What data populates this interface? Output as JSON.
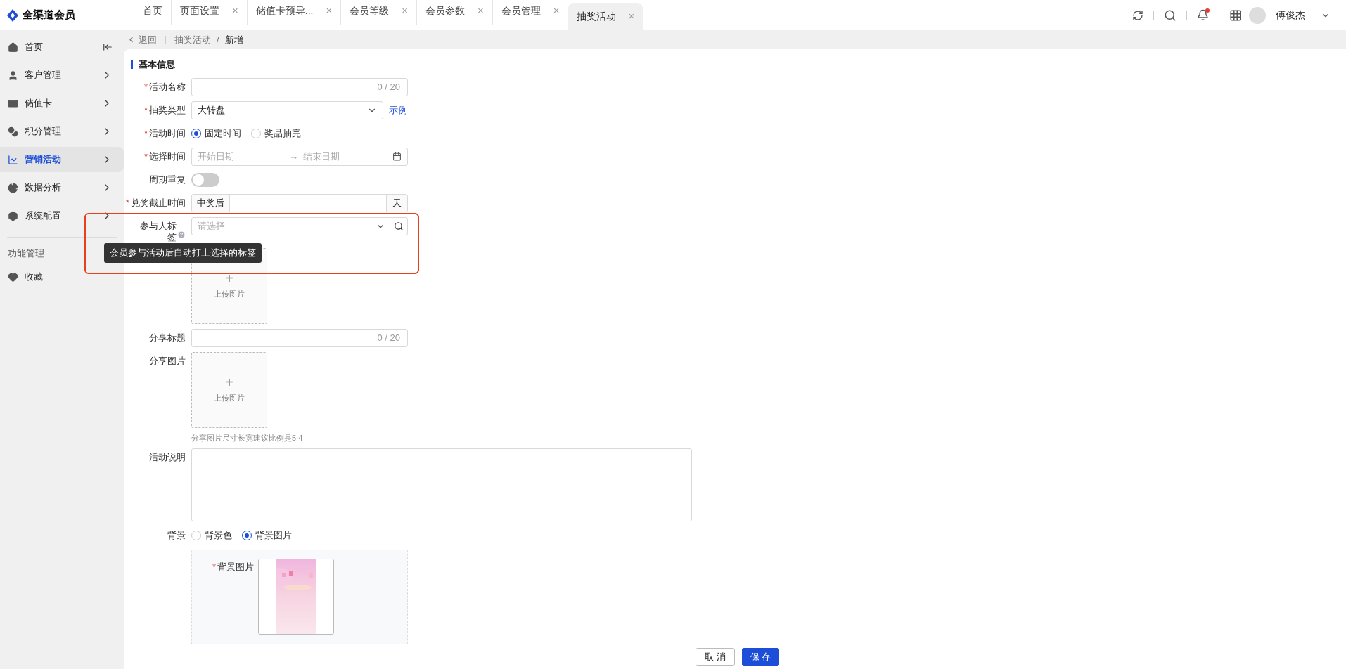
{
  "app": {
    "name": "全渠道会员"
  },
  "tabs": [
    {
      "label": "首页",
      "selected": false,
      "closable": false
    },
    {
      "label": "页面设置",
      "selected": false,
      "closable": true
    },
    {
      "label": "储值卡预导...",
      "selected": false,
      "closable": true
    },
    {
      "label": "会员等级",
      "selected": false,
      "closable": true
    },
    {
      "label": "会员参数",
      "selected": false,
      "closable": true
    },
    {
      "label": "会员管理",
      "selected": false,
      "closable": true
    },
    {
      "label": "抽奖活动",
      "selected": true,
      "closable": true
    }
  ],
  "close_glyph": "×",
  "user": {
    "name": "傅俊杰",
    "notification_dot": true
  },
  "sidebar": {
    "items": [
      {
        "label": "首页",
        "selected": false,
        "arrow": false
      },
      {
        "label": "客户管理",
        "selected": false,
        "arrow": true
      },
      {
        "label": "储值卡",
        "selected": false,
        "arrow": true
      },
      {
        "label": "积分管理",
        "selected": false,
        "arrow": true
      },
      {
        "label": "营销活动",
        "selected": true,
        "arrow": true
      },
      {
        "label": "数据分析",
        "selected": false,
        "arrow": true
      },
      {
        "label": "系统配置",
        "selected": false,
        "arrow": true
      }
    ],
    "section": "功能管理",
    "extra": [
      {
        "label": "收藏"
      }
    ]
  },
  "breadcrumb": {
    "back": "返回",
    "path": "抽奖活动",
    "separator": "/",
    "current": "新增"
  },
  "section_title": "基本信息",
  "fields": [
    {
      "kind": "text",
      "required_mark": "*",
      "label": "活动名称",
      "counter": "0 / 20"
    },
    {
      "kind": "select",
      "required_mark": "*",
      "label": "抽奖类型",
      "value": "大转盘",
      "link": "示例"
    },
    {
      "kind": "radio",
      "required_mark": "*",
      "label": "活动时间",
      "options": [
        {
          "label": "固定时间",
          "selected": true
        },
        {
          "label": "奖品抽完",
          "selected": false
        }
      ]
    },
    {
      "kind": "daterange",
      "required_mark": "*",
      "label": "选择时间",
      "start": "开始日期",
      "separator": "→",
      "end": "结束日期"
    },
    {
      "kind": "switch",
      "label": "周期重复",
      "on": false
    },
    {
      "kind": "addon",
      "required_mark": "*",
      "label": "兑奖截止时间",
      "prefix": "中奖后",
      "suffix": "天"
    },
    {
      "kind": "tagselect",
      "label": "参与人标签",
      "placeholder": "请选择",
      "help": true
    },
    {
      "kind": "upload",
      "plus": "+",
      "text": "上传图片"
    },
    {
      "kind": "text",
      "label": "分享标题",
      "counter": "0 / 20"
    },
    {
      "kind": "upload",
      "label": "分享图片",
      "plus": "+",
      "text": "上传图片",
      "hint": "分享图片尺寸长宽建议比例是5:4"
    },
    {
      "kind": "textarea",
      "label": "活动说明"
    },
    {
      "kind": "radio",
      "label": "背景",
      "options": [
        {
          "label": "背景色",
          "selected": false
        },
        {
          "label": "背景图片",
          "selected": true
        }
      ]
    },
    {
      "kind": "bgpanel",
      "required_mark": "*",
      "label": "背景图片"
    }
  ],
  "tooltip": "会员参与活动后自动打上选择的标签",
  "footer": {
    "cancel": "取 消",
    "save": "保 存"
  }
}
